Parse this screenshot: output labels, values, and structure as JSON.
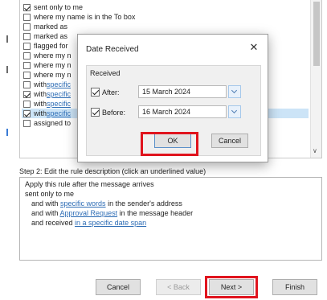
{
  "conditions": [
    {
      "checked": true,
      "selected": false,
      "text": "sent only to me",
      "link": ""
    },
    {
      "checked": false,
      "selected": false,
      "text": "where my name is in the To box",
      "link": ""
    },
    {
      "checked": false,
      "selected": false,
      "text": "marked as",
      "link": ""
    },
    {
      "checked": false,
      "selected": false,
      "text": "marked as",
      "link": ""
    },
    {
      "checked": false,
      "selected": false,
      "text": "flagged for",
      "link": ""
    },
    {
      "checked": false,
      "selected": false,
      "text": "where my n",
      "link": ""
    },
    {
      "checked": false,
      "selected": false,
      "text": "where my n",
      "link": ""
    },
    {
      "checked": false,
      "selected": false,
      "text": "where my n",
      "link": ""
    },
    {
      "checked": false,
      "selected": false,
      "text": "with ",
      "link": "specific"
    },
    {
      "checked": true,
      "selected": false,
      "text": "with ",
      "link": "specific"
    },
    {
      "checked": false,
      "selected": false,
      "text": "with ",
      "link": "specific"
    },
    {
      "checked": true,
      "selected": true,
      "text": "with ",
      "link": "specific"
    },
    {
      "checked": false,
      "selected": false,
      "text": "assigned to",
      "link": ""
    }
  ],
  "step2": {
    "label": "Step 2: Edit the rule description (click an underlined value)",
    "lines": [
      {
        "pre": "Apply this rule after the message arrives",
        "link": "",
        "post": ""
      },
      {
        "pre": "sent only to me",
        "link": "",
        "post": ""
      },
      {
        "pre": "and with ",
        "link": "specific words",
        "post": " in the sender's address"
      },
      {
        "pre": "and with ",
        "link": "Approval Request",
        "post": " in the message header"
      },
      {
        "pre": "and received ",
        "link": "in a specific date span",
        "post": ""
      }
    ]
  },
  "wizard_buttons": {
    "cancel": "Cancel",
    "back": "< Back",
    "next": "Next >",
    "finish": "Finish"
  },
  "dialog": {
    "title": "Date Received",
    "close_icon": "close-icon",
    "group_label": "Received",
    "after_label": "After:",
    "after_value": "15 March 2024",
    "before_label": "Before:",
    "before_value": "16 March 2024",
    "ok": "OK",
    "cancel": "Cancel"
  },
  "colors": {
    "highlight_box": "#e0141e",
    "link": "#2e6db5",
    "selection": "#cce4f7"
  }
}
